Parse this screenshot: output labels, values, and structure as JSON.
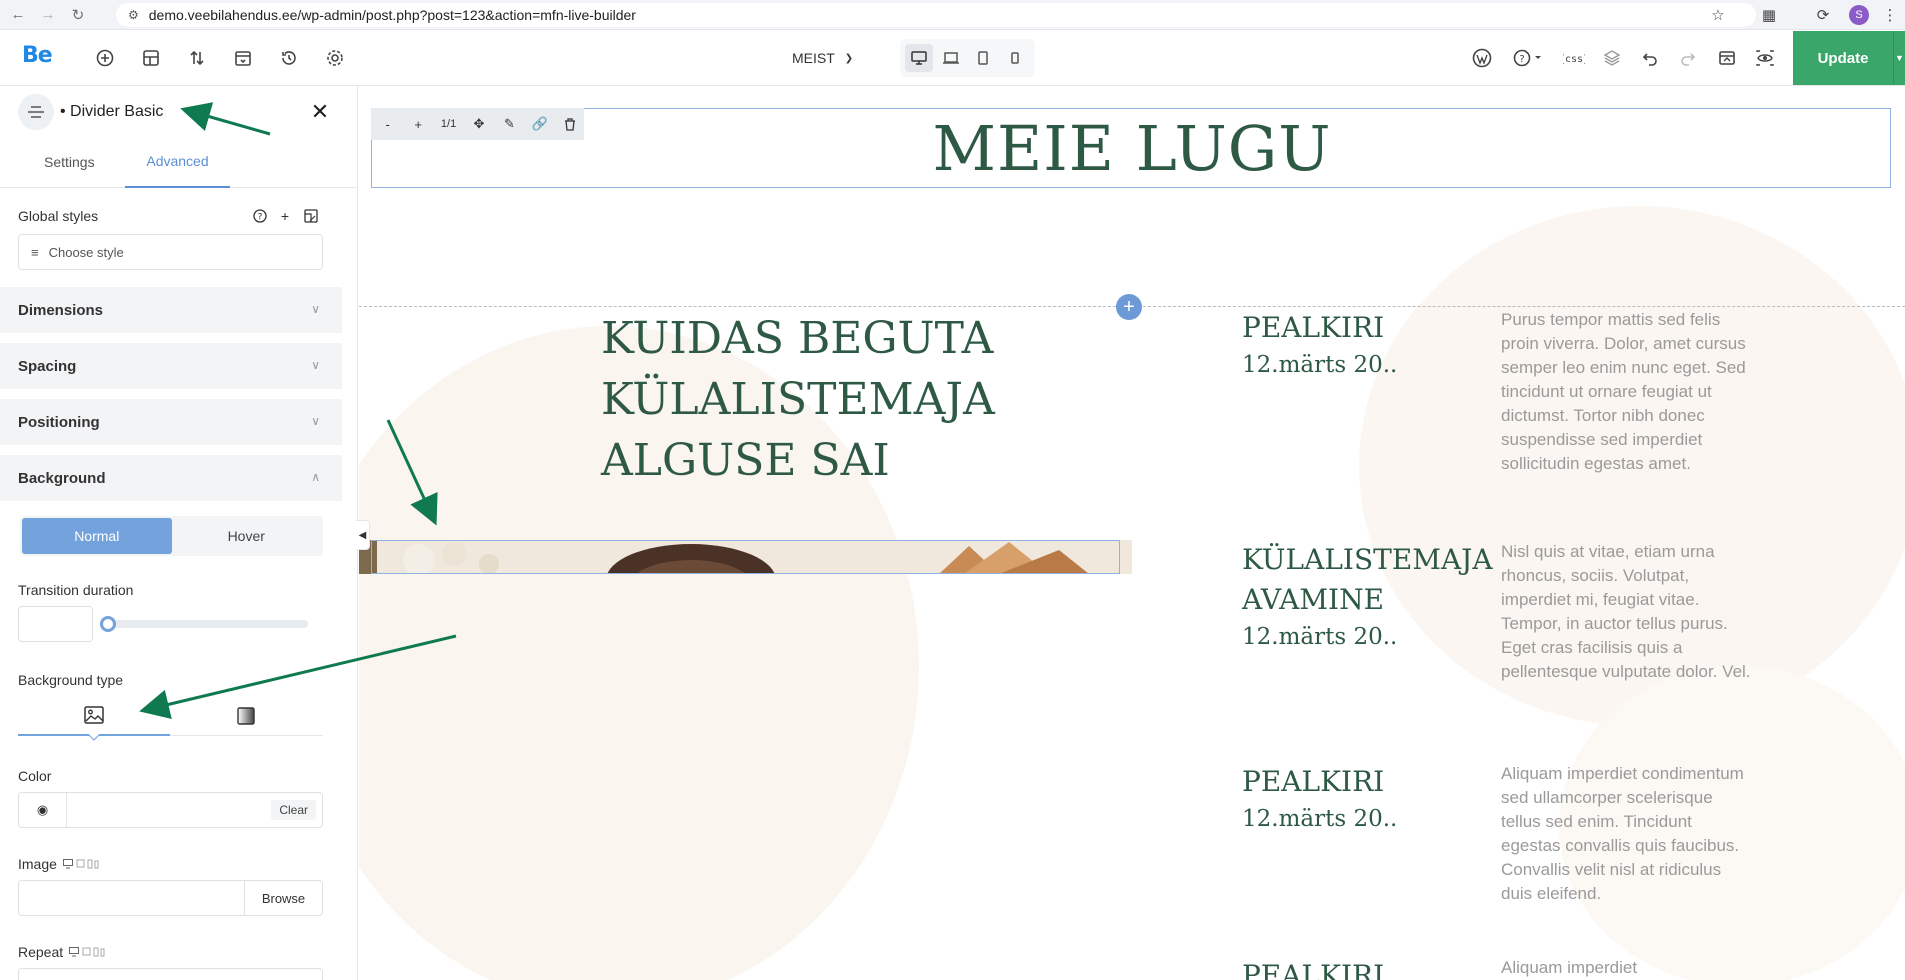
{
  "browser": {
    "url": "demo.veebilahendus.ee/wp-admin/post.php?post=123&action=mfn-live-builder",
    "profile_initial": "S"
  },
  "toolbar": {
    "logo": "Be",
    "page_name": "MEIST",
    "update_label": "Update"
  },
  "sidebar": {
    "element_title": "• Divider Basic",
    "tabs": [
      "Settings",
      "Advanced"
    ],
    "active_tab": "Advanced",
    "global_styles_label": "Global styles",
    "choose_style_placeholder": "Choose style",
    "accordions": [
      "Dimensions",
      "Spacing",
      "Positioning",
      "Background"
    ],
    "states": [
      "Normal",
      "Hover"
    ],
    "active_state": "Normal",
    "transition_label": "Transition duration",
    "transition_value": "",
    "background_type_label": "Background type",
    "background_types": [
      "image-icon",
      "gradient-icon"
    ],
    "active_background_type": "image-icon",
    "color_label": "Color",
    "color_value": "",
    "clear_label": "Clear",
    "image_label": "Image",
    "image_value": "",
    "browse_label": "Browse",
    "repeat_label": "Repeat"
  },
  "canvas": {
    "title": "MEIE LUGU",
    "mini_toolbar": [
      "-",
      "+",
      "1/1",
      "move-icon",
      "edit-icon",
      "link-icon",
      "trash-icon"
    ],
    "heading_lines": [
      "KUIDAS BEGUTA",
      "KÜLALISTEMAJA",
      "ALGUSE SAI"
    ],
    "events": [
      {
        "title_lines": [
          "PEALKIRI"
        ],
        "date": "12.märts 20..",
        "text": "Purus tempor mattis sed felis proin viverra. Dolor, amet cursus semper leo enim nunc eget. Sed tincidunt ut ornare feugiat ut dictumst. Tortor nibh donec suspendisse sed imperdiet sollicitudin egestas amet."
      },
      {
        "title_lines": [
          "KÜLALISTEMAJA",
          "AVAMINE"
        ],
        "date": "12.märts 20..",
        "text": "Nisl quis at vitae, etiam urna rhoncus, sociis. Volutpat, imperdiet mi, feugiat vitae. Tempor, in auctor tellus purus. Eget cras facilisis quis a pellentesque vulputate dolor. Vel."
      },
      {
        "title_lines": [
          "PEALKIRI"
        ],
        "date": "12.märts 20..",
        "text": "Aliquam imperdiet condimentum sed ullamcorper scelerisque tellus sed enim. Tincidunt egestas convallis quis faucibus. Convallis velit nisl at ridiculus duis eleifend."
      },
      {
        "title_lines": [
          "PEALKIRI"
        ],
        "date": "",
        "text": "Aliquam imperdiet"
      }
    ]
  },
  "colors": {
    "accent": "#74a2dc",
    "brand_green": "#3aa66a",
    "heading_green": "#2e5944",
    "annotation_arrow": "#0f7a4f"
  }
}
